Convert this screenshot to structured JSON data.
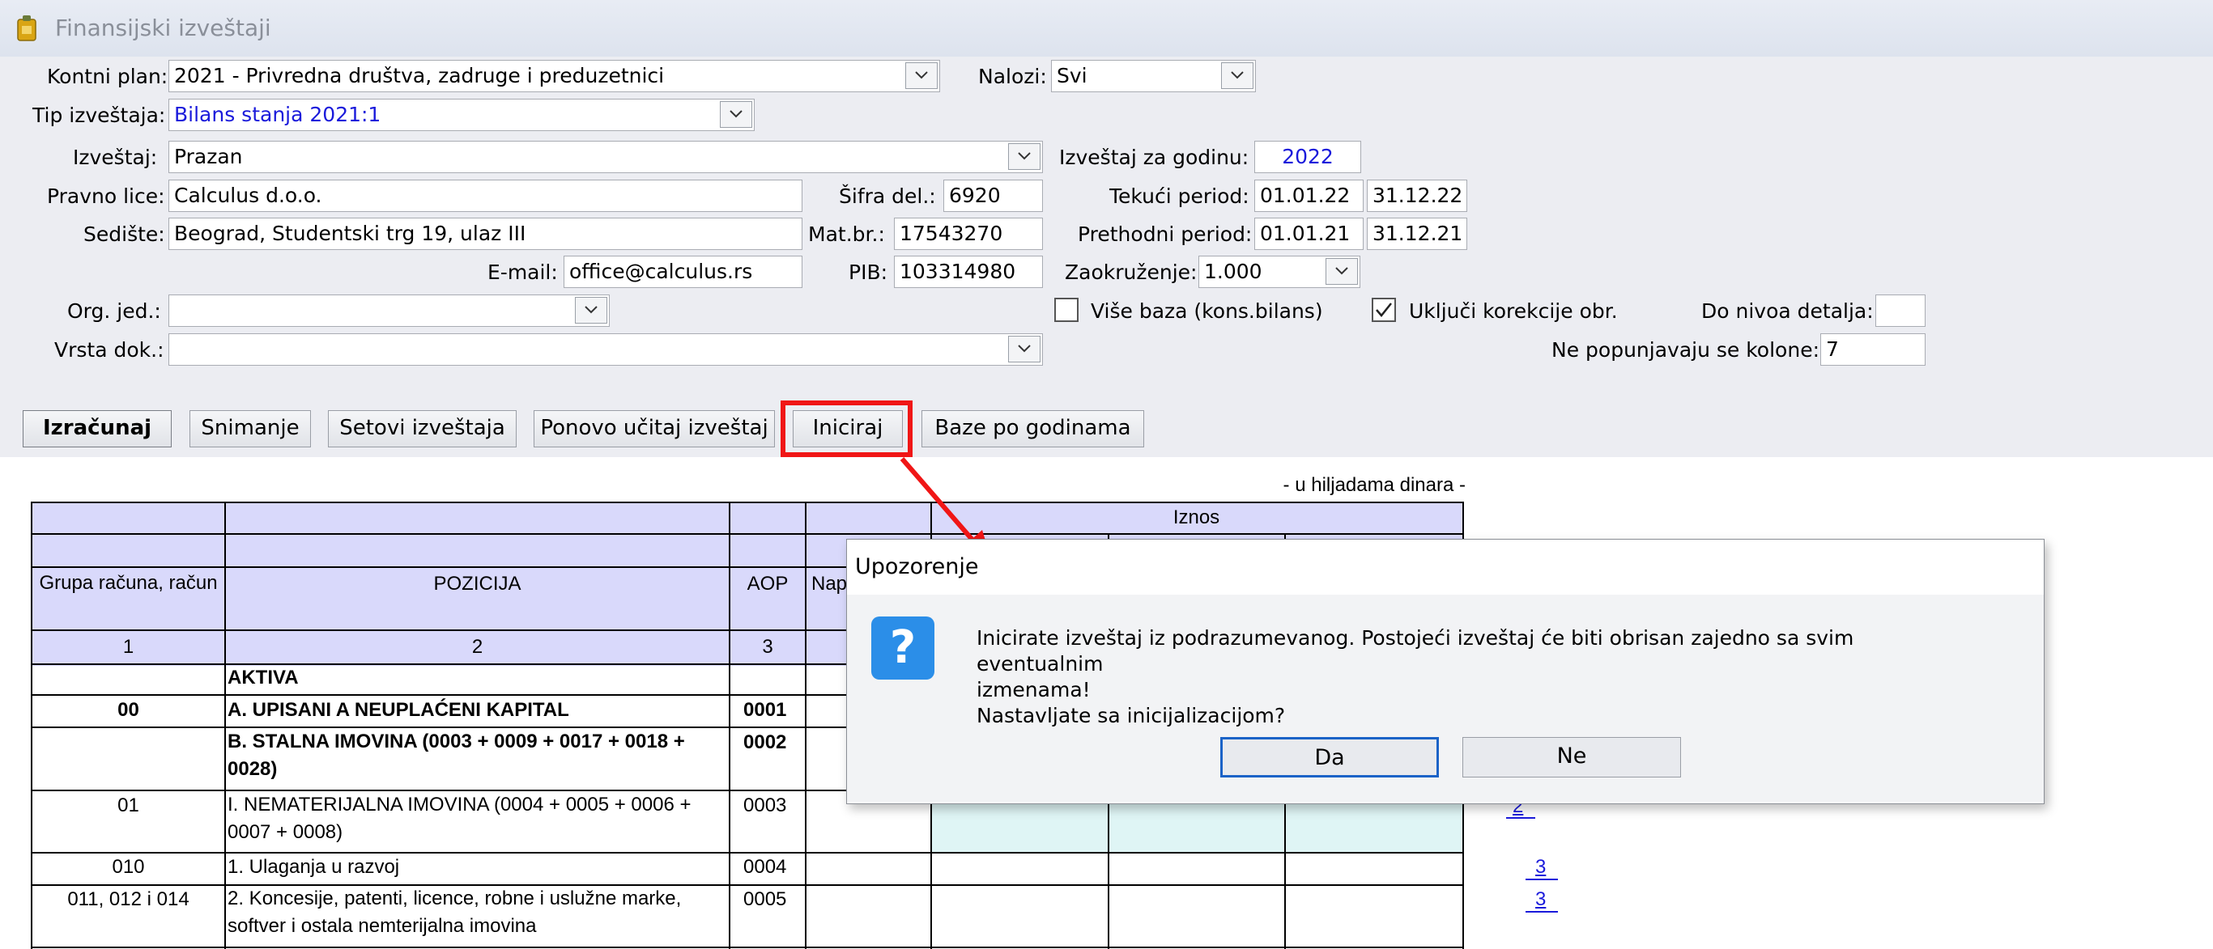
{
  "window": {
    "title": "Finansijski izveštaji"
  },
  "form": {
    "kontni_plan_label": "Kontni plan:",
    "kontni_plan_value": "2021 - Privredna društva, zadruge i preduzetnici",
    "nalozi_label": "Nalozi:",
    "nalozi_value": "Svi",
    "tip_label": "Tip izveštaja:",
    "tip_value": "Bilans stanja 2021:1",
    "izvestaj_label": "Izveštaj:",
    "izvestaj_value": "Prazan",
    "godina_label": "Izveštaj za godinu:",
    "godina_value": "2022",
    "pravno_lice_label": "Pravno lice:",
    "pravno_lice_value": "Calculus d.o.o.",
    "sifra_label": "Šifra del.:",
    "sifra_value": "6920",
    "tekuci_label": "Tekući period:",
    "tekuci_from": "01.01.22",
    "tekuci_to": "31.12.22",
    "sediste_label": "Sedište:",
    "sediste_value": "Beograd, Studentski trg 19, ulaz III",
    "matbr_label": "Mat.br.:",
    "matbr_value": "17543270",
    "prethodni_label": "Prethodni period:",
    "prethodni_from": "01.01.21",
    "prethodni_to": "31.12.21",
    "email_label": "E-mail:",
    "email_value": "office@calculus.rs",
    "pib_label": "PIB:",
    "pib_value": "103314980",
    "zaokruzenje_label": "Zaokruženje:",
    "zaokruzenje_value": "1.000",
    "orgjed_label": "Org. jed.:",
    "orgjed_value": "",
    "vise_baza_label": "Više baza (kons.bilans)",
    "vise_baza_checked": false,
    "ukljuci_label": "Uključi korekcije obr.",
    "ukljuci_checked": true,
    "do_nivoa_label": "Do nivoa detalja:",
    "do_nivoa_value": "",
    "vrsta_label": "Vrsta dok.:",
    "vrsta_value": "",
    "ne_popunjavaju_label": "Ne popunjavaju se kolone:",
    "ne_popunjavaju_value": "7"
  },
  "toolbar": {
    "izracunaj": "Izračunaj",
    "snimanje": "Snimanje",
    "setovi": "Setovi izveštaja",
    "ponovo": "Ponovo učitaj izveštaj",
    "iniciraj": "Iniciraj",
    "baze": "Baze po godinama"
  },
  "report": {
    "unit_note": "- u hiljadama dinara -",
    "iznos_header": "Iznos",
    "col_grupa": "Grupa računa, račun",
    "col_pozicija": "POZICIJA",
    "col_aop": "AOP",
    "col_nap": "Nap",
    "col_nums": [
      "1",
      "2",
      "3"
    ],
    "rows": [
      {
        "grupa": "",
        "pozicija": "AKTIVA",
        "aop": "",
        "bold": true
      },
      {
        "grupa": "00",
        "pozicija": "A. UPISANI A NEUPLAĆENI KAPITAL",
        "aop": "0001",
        "bold": true
      },
      {
        "grupa": "",
        "pozicija": "B. STALNA IMOVINA (0003 + 0009 + 0017 + 0018 + 0028)",
        "aop": "0002",
        "bold": true
      },
      {
        "grupa": "01",
        "pozicija": "I. NEMATERIJALNA IMOVINA (0004 + 0005 + 0006 + 0007 + 0008)",
        "aop": "0003",
        "bold": false
      },
      {
        "grupa": "010",
        "pozicija": "1. Ulaganja u razvoj",
        "aop": "0004",
        "bold": false
      },
      {
        "grupa": "011, 012 i 014",
        "pozicija": "2. Koncesije, patenti, licence, robne i uslužne marke, softver i ostala nemterijalna imovina",
        "aop": "0005",
        "bold": false
      }
    ],
    "side_links": [
      "2",
      "3",
      "3"
    ]
  },
  "dialog": {
    "title": "Upozorenje",
    "icon": "question-icon",
    "message_line1": "Inicirate izveštaj iz podrazumevanog. Postojeći izveštaj će biti obrisan zajedno sa svim eventualnim",
    "message_line2": "izmenama!",
    "message_line3": "Nastavljate sa inicijalizacijom?",
    "yes": "Da",
    "no": "Ne"
  },
  "colors": {
    "header_fill": "#d9d9fb",
    "cell_fill": "#dff5f5",
    "highlight": "#f01616",
    "accent": "#1b63c7"
  }
}
